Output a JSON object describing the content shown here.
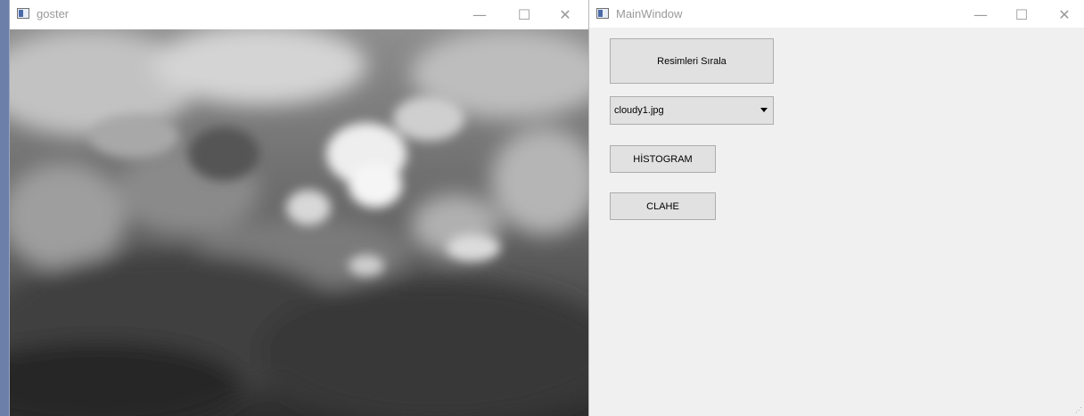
{
  "goster_window": {
    "title": "goster",
    "icon": "app-window-icon",
    "controls": {
      "minimize": "—",
      "maximize": "☐",
      "close": "✕"
    },
    "image": {
      "subject": "cloudy sky, grayscale"
    }
  },
  "main_window": {
    "title": "MainWindow",
    "icon": "app-window-icon",
    "controls": {
      "minimize": "—",
      "maximize": "☐",
      "close": "✕"
    },
    "sort_button_label": "Resimleri Sırala",
    "file_select": {
      "value": "cloudy1.jpg"
    },
    "histogram_button_label": "HİSTOGRAM",
    "clahe_button_label": "CLAHE"
  },
  "colors": {
    "client_bg": "#f0f0f0",
    "button_bg": "#e1e1e1",
    "button_border": "#adadad"
  }
}
